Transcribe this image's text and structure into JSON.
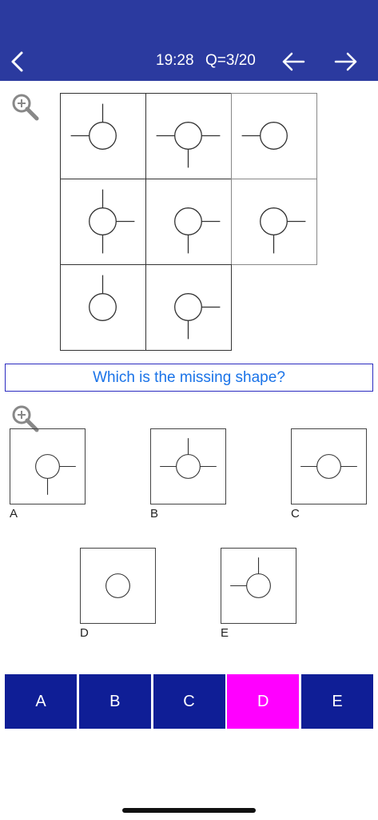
{
  "header": {
    "timer": "19:28",
    "question_counter": "Q=3/20",
    "back_icon": "chevron-left-icon",
    "prev_icon": "arrow-left-icon",
    "next_icon": "arrow-right-icon",
    "background_color": "#2b3a9f"
  },
  "puzzle": {
    "zoom_icon": "zoom-in-icon",
    "cells": [
      {
        "row": 1,
        "col": 1,
        "arms": [
          "left",
          "top"
        ]
      },
      {
        "row": 1,
        "col": 2,
        "arms": [
          "left",
          "right",
          "bottom"
        ]
      },
      {
        "row": 1,
        "col": 3,
        "arms": [
          "left"
        ]
      },
      {
        "row": 2,
        "col": 1,
        "arms": [
          "top",
          "bottom",
          "right"
        ]
      },
      {
        "row": 2,
        "col": 2,
        "arms": [
          "right",
          "bottom"
        ]
      },
      {
        "row": 2,
        "col": 3,
        "arms": [
          "right",
          "bottom"
        ]
      },
      {
        "row": 3,
        "col": 1,
        "arms": [
          "top"
        ]
      },
      {
        "row": 3,
        "col": 2,
        "arms": [
          "right",
          "bottom"
        ]
      }
    ]
  },
  "question": {
    "text": "Which is the missing shape?",
    "color": "#1a73e8"
  },
  "options": {
    "zoom_icon": "zoom-in-icon",
    "items": [
      {
        "label": "A",
        "arms": [
          "right",
          "bottom"
        ]
      },
      {
        "label": "B",
        "arms": [
          "left",
          "right",
          "top"
        ]
      },
      {
        "label": "C",
        "arms": [
          "left",
          "right"
        ]
      },
      {
        "label": "D",
        "arms": []
      },
      {
        "label": "E",
        "arms": [
          "left",
          "top"
        ]
      }
    ]
  },
  "answer_buttons": {
    "items": [
      {
        "label": "A",
        "selected": false
      },
      {
        "label": "B",
        "selected": false
      },
      {
        "label": "C",
        "selected": false
      },
      {
        "label": "D",
        "selected": true
      },
      {
        "label": "E",
        "selected": false
      }
    ],
    "default_color": "#0f1e96",
    "selected_color": "#ff00ff"
  }
}
